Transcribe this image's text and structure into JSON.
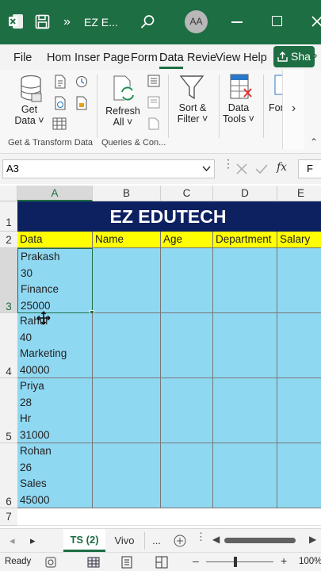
{
  "titlebar": {
    "doc_title": "EZ E...",
    "user_initials": "AA",
    "overflow": "»"
  },
  "menu": {
    "items": [
      "File",
      "Hom",
      "Inser",
      "Page",
      "Form",
      "Data",
      "Revie",
      "View",
      "Help"
    ],
    "active": "Data",
    "share_label": "Sha"
  },
  "ribbon": {
    "get_data": [
      "Get",
      "Data ˅"
    ],
    "refresh_all": [
      "Refresh",
      "All ˅"
    ],
    "sort_filter": [
      "Sort &",
      "Filter ˅"
    ],
    "data_tools": [
      "Data",
      "Tools ˅"
    ],
    "forecast": "For",
    "group_get_transform": "Get & Transform Data",
    "group_queries": "Queries & Con..."
  },
  "formula_bar": {
    "name_box": "A3",
    "fx_label": "F"
  },
  "sheet": {
    "columns": [
      "A",
      "B",
      "C",
      "D",
      "E"
    ],
    "title": "EZ EDUTECH",
    "headers": [
      "Data",
      "Name",
      "Age",
      "Department",
      "Salary"
    ],
    "row_numbers": [
      "1",
      "2",
      "3",
      "4",
      "5",
      "6",
      "7"
    ],
    "records": [
      [
        "Prakash",
        "30",
        "Finance",
        "25000"
      ],
      [
        "Rahul",
        "40",
        "Marketing",
        "40000"
      ],
      [
        "Priya",
        "28",
        "Hr",
        "31000"
      ],
      [
        "Rohan",
        "26",
        "Sales",
        "45000"
      ]
    ]
  },
  "tabs": {
    "sheets": [
      "TS (2)",
      "Vivo"
    ],
    "active": "TS (2)",
    "more": "..."
  },
  "status": {
    "ready": "Ready",
    "zoom": "100%"
  },
  "colors": {
    "excel_green": "#1e6e43",
    "title_navy": "#0d2060",
    "header_yellow": "#ffff00",
    "cell_blue": "#8fd8f2"
  }
}
